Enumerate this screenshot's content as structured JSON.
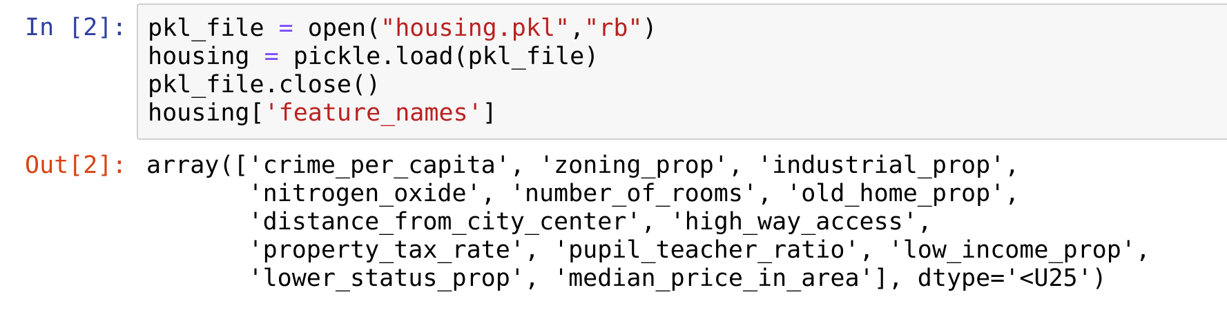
{
  "cell": {
    "in_prompt": "In [2]:",
    "out_prompt": "Out[2]:",
    "code_lines": [
      {
        "var": "pkl_file",
        "op": " = ",
        "func": "open(",
        "arg1": "\"housing.pkl\"",
        "comma": ",",
        "arg2": "\"rb\"",
        "close": ")"
      },
      {
        "var": "housing",
        "op": " = ",
        "rest": "pickle.load(pkl_file)"
      },
      {
        "text": "pkl_file.close()"
      },
      {
        "obj": "housing[",
        "key": "'feature_names'",
        "close": "]"
      }
    ],
    "output_lines": [
      "array(['crime_per_capita', 'zoning_prop', 'industrial_prop',",
      "       'nitrogen_oxide', 'number_of_rooms', 'old_home_prop',",
      "       'distance_from_city_center', 'high_way_access',",
      "       'property_tax_rate', 'pupil_teacher_ratio', 'low_income_prop',",
      "       'lower_status_prop', 'median_price_in_area'], dtype='<U25')"
    ]
  },
  "colors": {
    "in_prompt": "#303f9f",
    "out_prompt": "#d84315",
    "operator": "#7c4dff",
    "string": "#ba2121",
    "input_background": "#f7f7f7",
    "input_border": "#cfcfcf"
  }
}
